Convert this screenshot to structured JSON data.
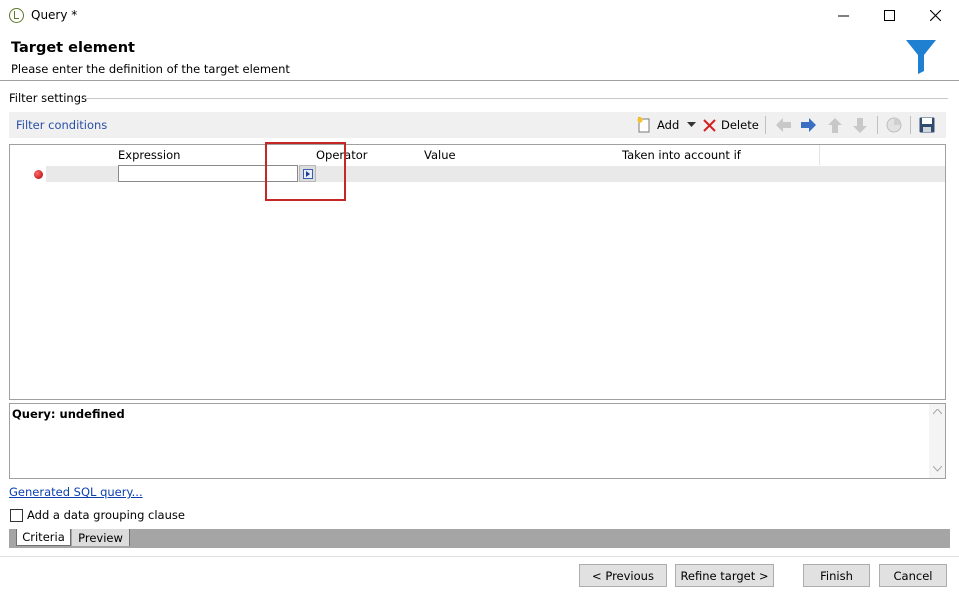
{
  "window": {
    "title": "Query *"
  },
  "header": {
    "title": "Target element",
    "subtitle": "Please enter the definition of the target element"
  },
  "filter_settings": {
    "label": "Filter settings"
  },
  "toolbar": {
    "section_label": "Filter conditions",
    "add_label": "Add",
    "delete_label": "Delete"
  },
  "grid": {
    "columns": [
      "Expression",
      "Operator",
      "Value",
      "Taken into account if"
    ],
    "rows": [
      {
        "expression": "",
        "operator": "",
        "value": "",
        "condition": ""
      }
    ]
  },
  "query": {
    "text": "Query: undefined"
  },
  "links": {
    "sql": "Generated SQL query..."
  },
  "grouping": {
    "label": "Add a data grouping clause",
    "checked": false
  },
  "tabs": [
    {
      "label": "Criteria",
      "active": true
    },
    {
      "label": "Preview",
      "active": false
    }
  ],
  "buttons": {
    "previous": "< Previous",
    "refine": "Refine target >",
    "finish": "Finish",
    "cancel": "Cancel"
  },
  "colors": {
    "accent": "#1f7fd1",
    "link": "#0b3fb0",
    "highlight": "#c62828"
  }
}
